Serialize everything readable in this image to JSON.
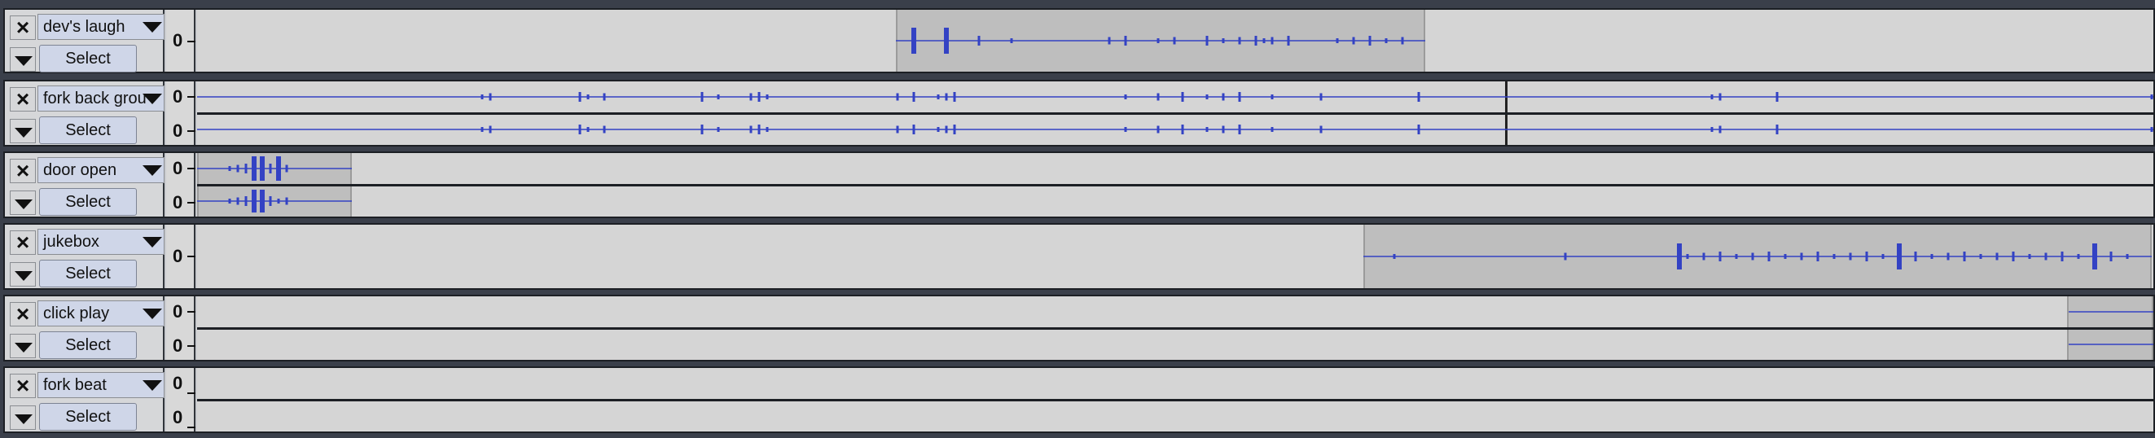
{
  "window": {
    "title": ""
  },
  "colors": {
    "waveform": "#3342c4",
    "lane_bg": "#d5d5d5",
    "clip_bg": "#bebebe",
    "name_bg": "#cfd6e8"
  },
  "icons": {
    "close": "close-icon",
    "menu": "chevron-down-icon",
    "collapse": "collapse-icon"
  },
  "tracks": [
    {
      "id": "devs-laugh",
      "name": "dev's laugh",
      "close_label": "×",
      "select_label": "Select",
      "channels": [
        "0"
      ],
      "stereo": false
    },
    {
      "id": "fork-back",
      "name": "fork back grou",
      "close_label": "×",
      "select_label": "Select",
      "channels": [
        "0",
        "0"
      ],
      "stereo": true
    },
    {
      "id": "door-open",
      "name": "door open",
      "close_label": "×",
      "select_label": "Select",
      "channels": [
        "0",
        "0"
      ],
      "stereo": true
    },
    {
      "id": "jukebox",
      "name": "jukebox",
      "close_label": "×",
      "select_label": "Select",
      "channels": [
        "0"
      ],
      "stereo": false
    },
    {
      "id": "click-play",
      "name": "click play",
      "close_label": "×",
      "select_label": "Select",
      "channels": [
        "0",
        "0"
      ],
      "stereo": true
    },
    {
      "id": "fork-beat",
      "name": "fork beat",
      "close_label": "×",
      "select_label": "Select",
      "channels": [
        "0",
        "0"
      ],
      "stereo": true
    }
  ]
}
